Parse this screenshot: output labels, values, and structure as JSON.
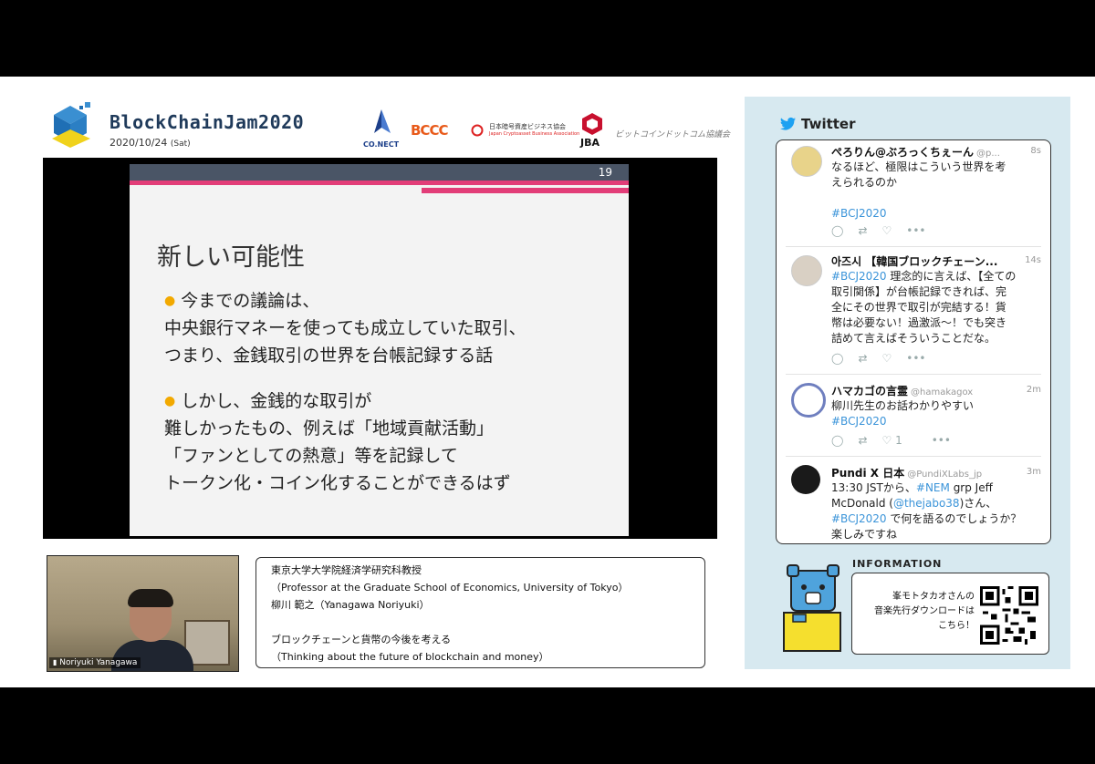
{
  "event": {
    "title": "BlockChainJam2020",
    "date": "2020/10/24",
    "weekday": "(Sat)"
  },
  "sponsors": [
    "CO.NECT",
    "BCCC",
    "日本暗号資産ビジネス協会",
    "Japan Cryptoasset Business Association",
    "JBA",
    "ビットコインドットコム協議会"
  ],
  "slide": {
    "page_number": "19",
    "heading": "新しい可能性",
    "bullet1": [
      "今までの議論は、",
      "中央銀行マネーを使っても成立していた取引、",
      "つまり、金銭取引の世界を台帳記録する話"
    ],
    "bullet2": [
      "しかし、金銭的な取引が",
      "難しかったもの、例えば「地域貢献活動」",
      "「ファンとしての熱意」等を記録して",
      "トークン化・コイン化することができるはず"
    ]
  },
  "speaker": {
    "camera_label": "Noriyuki Yanagawa",
    "caption": [
      "東京大学大学院経済学研究科教授",
      "（Professor at the Graduate School of Economics, University of Tokyo）",
      "柳川 範之（Yanagawa Noriyuki）",
      "ブロックチェーンと貨幣の今後を考える",
      "（Thinking about the future of blockchain and money）"
    ]
  },
  "twitter": {
    "title": "Twitter",
    "tweets": [
      {
        "name": "ぺろりん@ぶろっくちぇーん",
        "handle": "@p...",
        "time": "8s",
        "lines": [
          "なるほど、極限はこういう世界を考",
          "えられるのか"
        ],
        "tag": "#BCJ2020",
        "likes": ""
      },
      {
        "name": "아즈시 【韓国ブロックチェーン...",
        "handle": "",
        "time": "14s",
        "lines": [
          "理念的に言えば、【全ての",
          "取引関係】が台帳記録できれば、完",
          "全にその世界で取引が完結する！貨",
          "幣は必要ない！過激派〜！でも突き",
          "詰めて言えばそういうことだな。"
        ],
        "tag": "#BCJ2020",
        "likes": ""
      },
      {
        "name": "ハマカゴの言霊",
        "handle": "@hamakagox",
        "time": "2m",
        "lines": [
          "柳川先生のお話わかりやすい"
        ],
        "tag": "#BCJ2020",
        "likes": "1"
      },
      {
        "name": "Pundi X 日本",
        "handle": "@PundiXLabs_jp",
        "time": "3m",
        "lines": [
          "13:30 JSTから、",
          "grp Jeff",
          "McDonald (",
          "さん、",
          "で何を語るのでしょうか？",
          "楽しみですね"
        ],
        "tags": [
          "#NEM",
          "@thejabo38",
          "#BCJ2020"
        ]
      }
    ]
  },
  "information": {
    "title": "INFORMATION",
    "text": [
      "峯モトタカオさんの",
      "音楽先行ダウンロードは",
      "こちら！"
    ]
  },
  "colors": {
    "slide_accent": "#e23d78",
    "bullet": "#f2a900",
    "twitter_panel": "#d7e9f0",
    "hashtag": "#3b94d9"
  }
}
